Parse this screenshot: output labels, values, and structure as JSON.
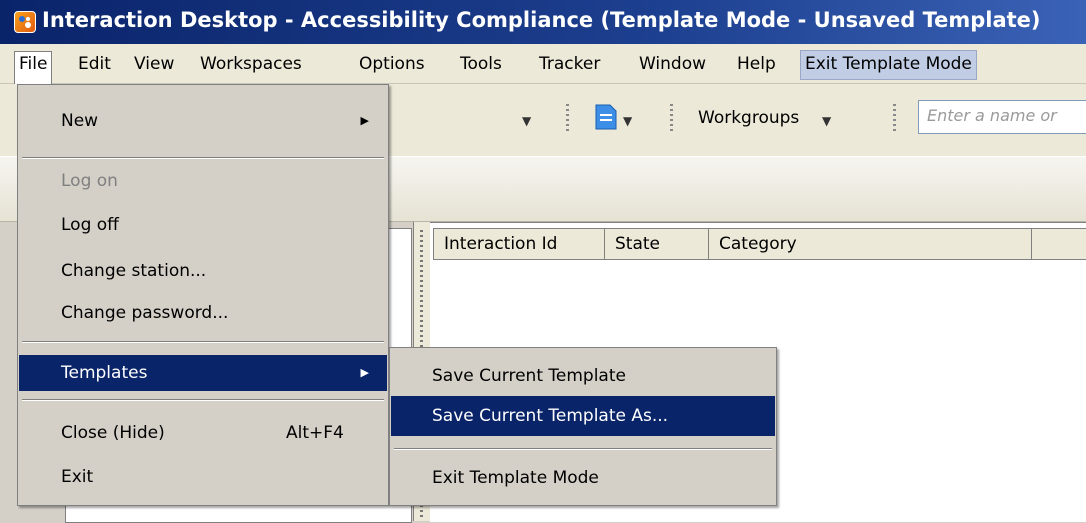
{
  "window": {
    "title": "Interaction Desktop - Accessibility Compliance (Template Mode - Unsaved Template)"
  },
  "menubar": {
    "items": [
      {
        "label": "File"
      },
      {
        "label": "Edit"
      },
      {
        "label": "View"
      },
      {
        "label": "Workspaces"
      },
      {
        "label": "Options"
      },
      {
        "label": "Tools"
      },
      {
        "label": "Tracker"
      },
      {
        "label": "Window"
      },
      {
        "label": "Help"
      },
      {
        "label": "Exit Template Mode"
      }
    ]
  },
  "toolbar": {
    "workgroups_label": "Workgroups",
    "name_input_placeholder": "Enter a name or"
  },
  "grid": {
    "columns": [
      "Interaction Id",
      "State",
      "Category"
    ]
  },
  "file_menu": {
    "new": "New",
    "log_on": "Log on",
    "log_off": "Log off",
    "change_station": "Change station...",
    "change_password": "Change password...",
    "templates": "Templates",
    "close_hide": "Close (Hide)",
    "close_hide_shortcut": "Alt+F4",
    "exit": "Exit"
  },
  "templates_submenu": {
    "save_current": "Save Current Template",
    "save_current_as": "Save Current Template As...",
    "exit_template_mode": "Exit Template Mode"
  },
  "colors": {
    "highlight": "#0a246a",
    "menu_background": "#d4d0c8",
    "titlebar": "#0a246a"
  }
}
